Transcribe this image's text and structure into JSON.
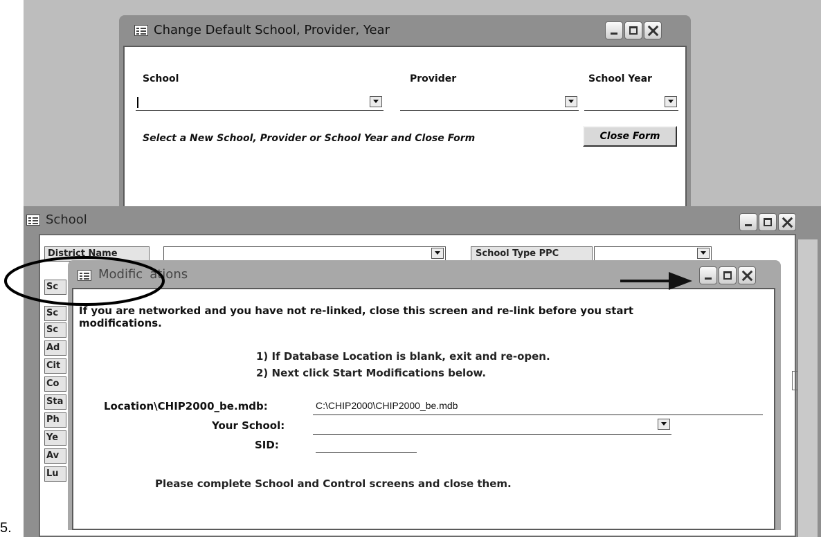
{
  "step_label": "5.",
  "change_default_form": {
    "title": "Change Default School, Provider, Year",
    "labels": {
      "school": "School",
      "provider": "Provider",
      "school_year": "School Year"
    },
    "values": {
      "school": "",
      "provider": "",
      "school_year": ""
    },
    "instruction": "Select a New School,  Provider or School Year and Close Form",
    "close_button": "Close Form"
  },
  "school_window": {
    "title": "School",
    "district_label": "District Name",
    "school_type_label": "School Type PPC",
    "side_buttons": [
      "Sc",
      "Sc",
      "Sc",
      "Ad",
      "Cit",
      "Co",
      "Sta",
      "Ph",
      "Ye",
      "Av",
      "Lu"
    ]
  },
  "modifications": {
    "title": "Modifications",
    "title_visible": "Modific",
    "title_rest": "ations",
    "warning": "If you are networked and you have not re-linked, close this screen and re-link before you start modifications.",
    "step1": "1)  If Database Location is blank, exit and re-open.",
    "step2": "2)  Next click Start Modifications below.",
    "location_label": "Location\\CHIP2000_be.mdb:",
    "location_value": "C:\\CHIP2000\\CHIP2000_be.mdb",
    "your_school_label": "Your School:",
    "your_school_value": "",
    "sid_label": "SID:",
    "sid_value": "",
    "footer": "Please complete School and Control screens and close them."
  },
  "annotations": {
    "circle": "title-highlight",
    "arrow": "pointing to window controls"
  }
}
